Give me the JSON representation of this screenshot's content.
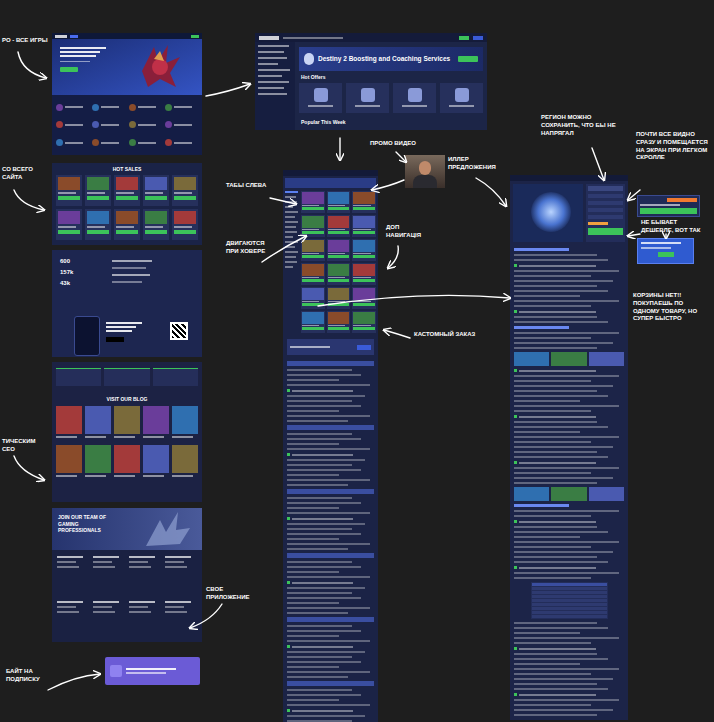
{
  "annotations": [
    {
      "text": "РО - ВСЕ ИГРЫ"
    },
    {
      "text": "СО ВСЕГО САЙТА"
    },
    {
      "text": "ТИЧЕСКИМ СЕО"
    },
    {
      "text": "БАЙТ НА ПОДПИСКУ"
    },
    {
      "text": "СВОЕ ПРИЛОЖЕНИЕ"
    },
    {
      "text": "ТАБЫ СЛЕВА"
    },
    {
      "text": "ДВИГАЮТСЯ ПРИ ХОВЕРЕ"
    },
    {
      "text": "ПРОМО ВИДЕО"
    },
    {
      "text": "ИЛЛЕР ПРЕДЛОЖЕНИЯ"
    },
    {
      "text": "ДОП НАВИГАЦІЯ"
    },
    {
      "text": "КАСТОМНЫЙ ЗАКАЗ"
    },
    {
      "text": "РЕГИОН МОЖНО СОХРАНИТЬ, ЧТО БЫ НЕ НАПРЯГАЛ"
    },
    {
      "text": "ПОЧТИ ВСЕ ВИДНО СРАЗУ И ПОМЕЩАЕТСЯ НА ЭКРАН ПРИ ЛЕГКОМ СКРОЛЛЕ"
    },
    {
      "text": "НЕ БЫВАЕТ ДЕШЕВЛЕ, ВОТ ТАК"
    },
    {
      "text": "КОРЗИНЫ НЕТ!! ПОКУПАЕШЬ ПО ОДНОМУ ТОВАРУ, НО СУПЕР БЫСТРО"
    }
  ],
  "home": {
    "hot_sales_title": "HOT SALES",
    "stats": [
      "600",
      "157k",
      "43k"
    ],
    "blog_title": "VISIT OUR BLOG",
    "join_title": "JOIN OUR TEAM OF GAMING PROFESSIONALS"
  },
  "category": {
    "title": "Destiny 2 Boosting and Coaching Services",
    "hot_offers": "Hot Offers",
    "popular": "Popular This Week"
  }
}
